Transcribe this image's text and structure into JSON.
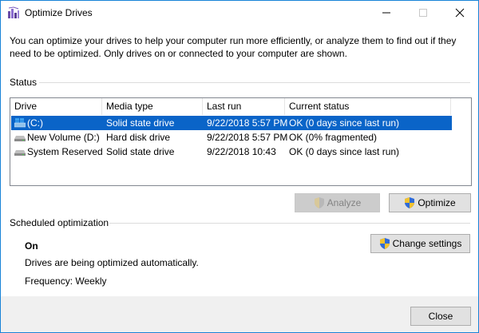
{
  "window": {
    "title": "Optimize Drives",
    "accent_color": "#1883d7"
  },
  "intro": {
    "text": "You can optimize your drives to help your computer run more efficiently, or analyze them to find out if they need to be optimized. Only drives on or connected to your computer are shown."
  },
  "status": {
    "label": "Status",
    "columns": [
      "Drive",
      "Media type",
      "Last run",
      "Current status"
    ],
    "drives": [
      {
        "drive": "(C:)",
        "media": "Solid state drive",
        "last_run": "9/22/2018 5:57 PM",
        "status": "OK (0 days since last run)",
        "selected": true,
        "icon": "windows-drive-icon"
      },
      {
        "drive": "New Volume (D:)",
        "media": "Hard disk drive",
        "last_run": "9/22/2018 5:57 PM",
        "status": "OK (0% fragmented)",
        "selected": false,
        "icon": "drive-icon"
      },
      {
        "drive": "System Reserved",
        "media": "Solid state drive",
        "last_run": "9/22/2018 10:43",
        "status": "OK (0 days since last run)",
        "selected": false,
        "icon": "drive-icon"
      }
    ],
    "selection_color": "#0a64c8"
  },
  "buttons": {
    "analyze": "Analyze",
    "optimize": "Optimize",
    "change_settings": "Change settings",
    "close": "Close"
  },
  "scheduled": {
    "label": "Scheduled optimization",
    "state": "On",
    "description": "Drives are being optimized automatically.",
    "frequency": "Frequency: Weekly"
  }
}
